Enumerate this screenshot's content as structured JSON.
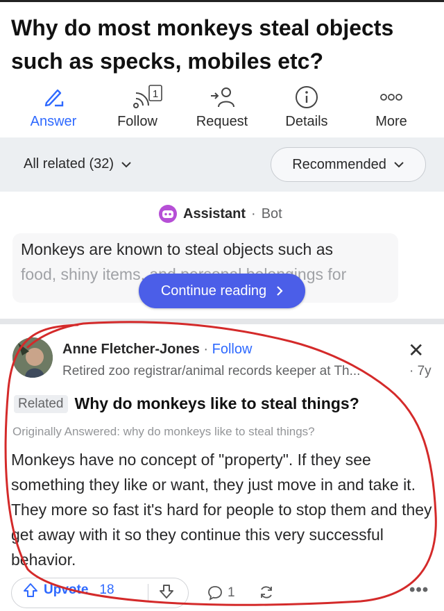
{
  "question": {
    "title": "Why do most monkeys steal objects such as specks, mobiles etc?"
  },
  "actions": {
    "answer": "Answer",
    "follow": "Follow",
    "follow_badge": "1",
    "request": "Request",
    "details": "Details",
    "more": "More"
  },
  "filter": {
    "related": "All related (32)",
    "sort": "Recommended"
  },
  "assistant": {
    "name": "Assistant",
    "separator": "·",
    "type": "Bot",
    "text_line1": "Monkeys are known to steal objects such as",
    "text_line2": "food, shiny items, and personal belongings for",
    "continue": "Continue reading"
  },
  "answer": {
    "author": "Anne Fletcher-Jones",
    "separator": "·",
    "follow": "Follow",
    "credential": "Retired zoo registrar/animal records keeper at Th...",
    "age": "· 7y",
    "related_tag": "Related",
    "related_question": "Why do monkeys like to steal things?",
    "originally": "Originally Answered: why do monkeys like to steal things?",
    "body": "Monkeys have no concept of \"property\". If they see something they like or want, they just move in and take it. They more so fast it's hard for people to stop them and they get away with it so they continue this very successful behavior."
  },
  "footer": {
    "upvote": "Upvote",
    "upvote_count": "18",
    "comments": "1",
    "more": "•••"
  },
  "colors": {
    "accent": "#2e69ff",
    "continue_button": "#4b5ee8",
    "annotation": "#d42a2a"
  }
}
